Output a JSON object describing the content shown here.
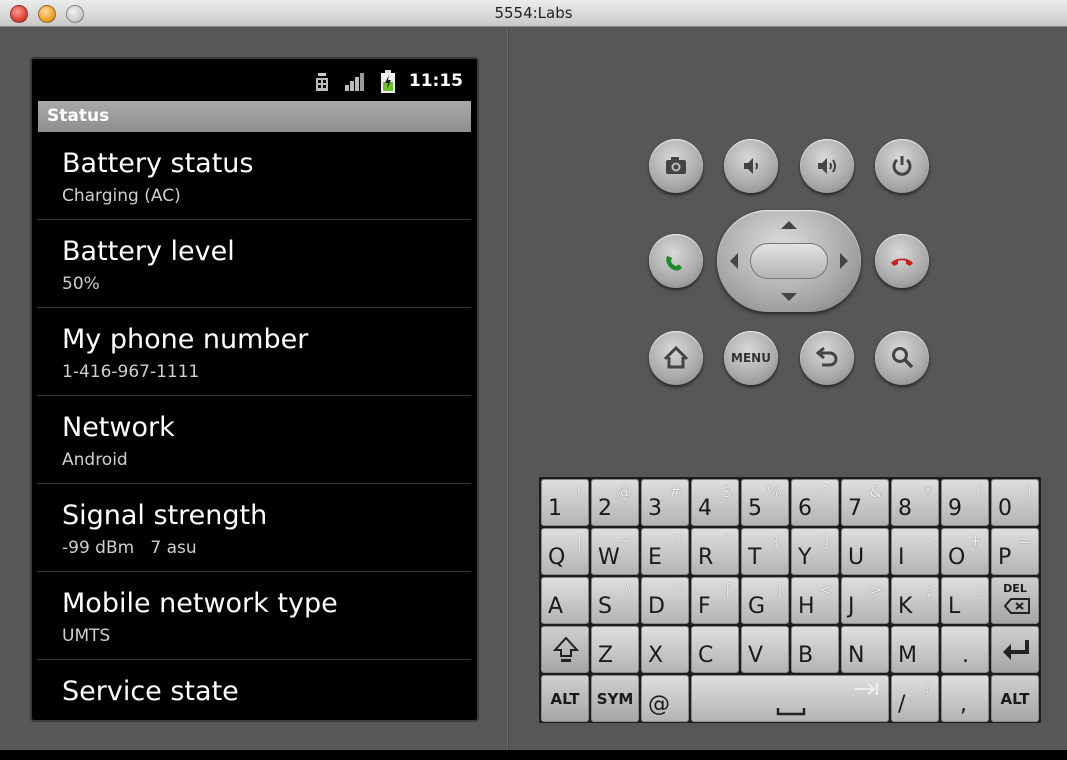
{
  "window": {
    "title": "5554:Labs"
  },
  "statusbar": {
    "time": "11:15"
  },
  "screen": {
    "header": "Status",
    "items": [
      {
        "title": "Battery status",
        "subtitle": "Charging (AC)"
      },
      {
        "title": "Battery level",
        "subtitle": "50%"
      },
      {
        "title": "My phone number",
        "subtitle": "1-416-967-1111"
      },
      {
        "title": "Network",
        "subtitle": "Android"
      },
      {
        "title": "Signal strength",
        "subtitle": "-99 dBm   7 asu"
      },
      {
        "title": "Mobile network type",
        "subtitle": "UMTS"
      },
      {
        "title": "Service state",
        "subtitle": ""
      }
    ]
  },
  "controls": {
    "menu_label": "MENU"
  },
  "keyboard": {
    "rows": [
      [
        {
          "m": "1",
          "a": "!"
        },
        {
          "m": "2",
          "a": "@"
        },
        {
          "m": "3",
          "a": "#"
        },
        {
          "m": "4",
          "a": "$"
        },
        {
          "m": "5",
          "a": "%"
        },
        {
          "m": "6",
          "a": "^"
        },
        {
          "m": "7",
          "a": "&"
        },
        {
          "m": "8",
          "a": "*"
        },
        {
          "m": "9",
          "a": "("
        },
        {
          "m": "0",
          "a": ")"
        }
      ],
      [
        {
          "m": "Q",
          "a": "|"
        },
        {
          "m": "W",
          "a": "~"
        },
        {
          "m": "E",
          "a": "\""
        },
        {
          "m": "R",
          "a": "`"
        },
        {
          "m": "T",
          "a": "{"
        },
        {
          "m": "Y",
          "a": "}"
        },
        {
          "m": "U",
          "a": "-"
        },
        {
          "m": "I",
          "a": "-"
        },
        {
          "m": "O",
          "a": "+"
        },
        {
          "m": "P",
          "a": "="
        }
      ],
      [
        {
          "m": "A",
          "a": ""
        },
        {
          "m": "S",
          "a": "\\"
        },
        {
          "m": "D",
          "a": "'"
        },
        {
          "m": "F",
          "a": "["
        },
        {
          "m": "G",
          "a": "]"
        },
        {
          "m": "H",
          "a": "<"
        },
        {
          "m": "J",
          "a": ">"
        },
        {
          "m": "K",
          "a": ";"
        },
        {
          "m": "L",
          "a": ":"
        },
        {
          "c": "DEL"
        }
      ],
      [
        {
          "c": "shift"
        },
        {
          "m": "Z",
          "a": ""
        },
        {
          "m": "X",
          "a": ""
        },
        {
          "m": "C",
          "a": ""
        },
        {
          "m": "V",
          "a": ""
        },
        {
          "m": "B",
          "a": ""
        },
        {
          "m": "N",
          "a": ""
        },
        {
          "m": "M",
          "a": ""
        },
        {
          "m": ".",
          "a": ""
        },
        {
          "c": "enter"
        }
      ],
      [
        {
          "c": "ALT"
        },
        {
          "c": "SYM"
        },
        {
          "m": "@",
          "a": ""
        },
        {
          "c": "space"
        },
        {
          "m": "/",
          "a": "?"
        },
        {
          "m": ",",
          "a": ""
        },
        {
          "c": "ALT"
        }
      ]
    ]
  }
}
